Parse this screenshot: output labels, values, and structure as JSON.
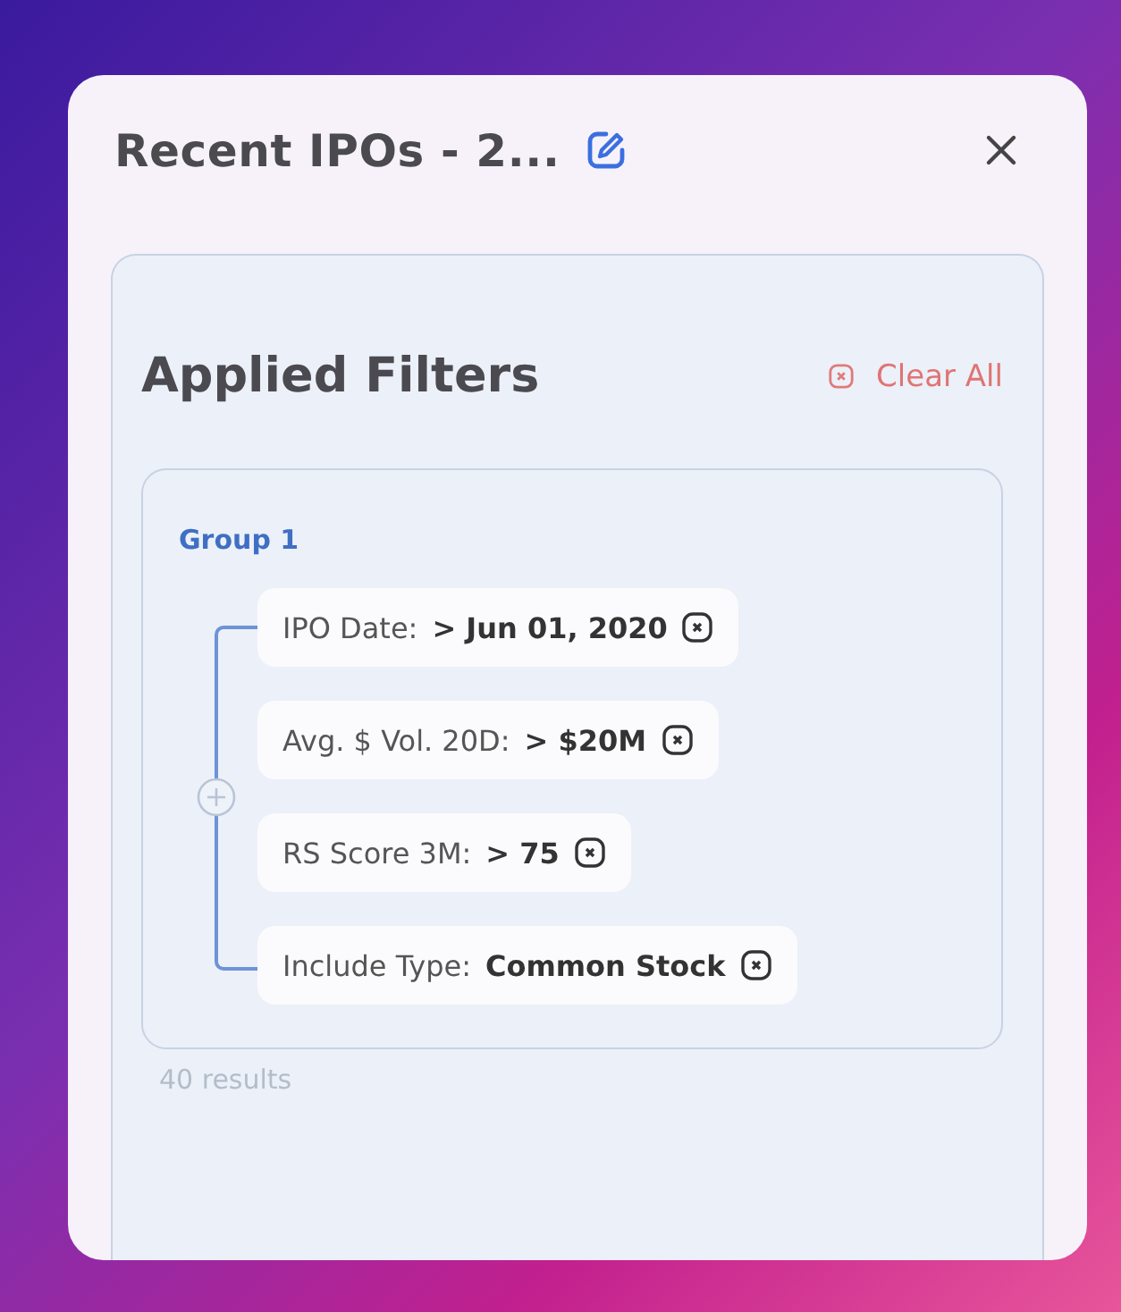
{
  "panel": {
    "title": "Recent IPOs - 2..."
  },
  "filters_section": {
    "heading": "Applied Filters",
    "clear_label": "Clear All"
  },
  "group": {
    "title": "Group 1",
    "filters": [
      {
        "label": "IPO Date:",
        "value": "> Jun 01, 2020"
      },
      {
        "label": "Avg. $ Vol. 20D:",
        "value": "> $20M"
      },
      {
        "label": "RS Score 3M:",
        "value": "> 75"
      },
      {
        "label": "Include Type:",
        "value": "Common Stock"
      }
    ]
  },
  "results": "40 results"
}
